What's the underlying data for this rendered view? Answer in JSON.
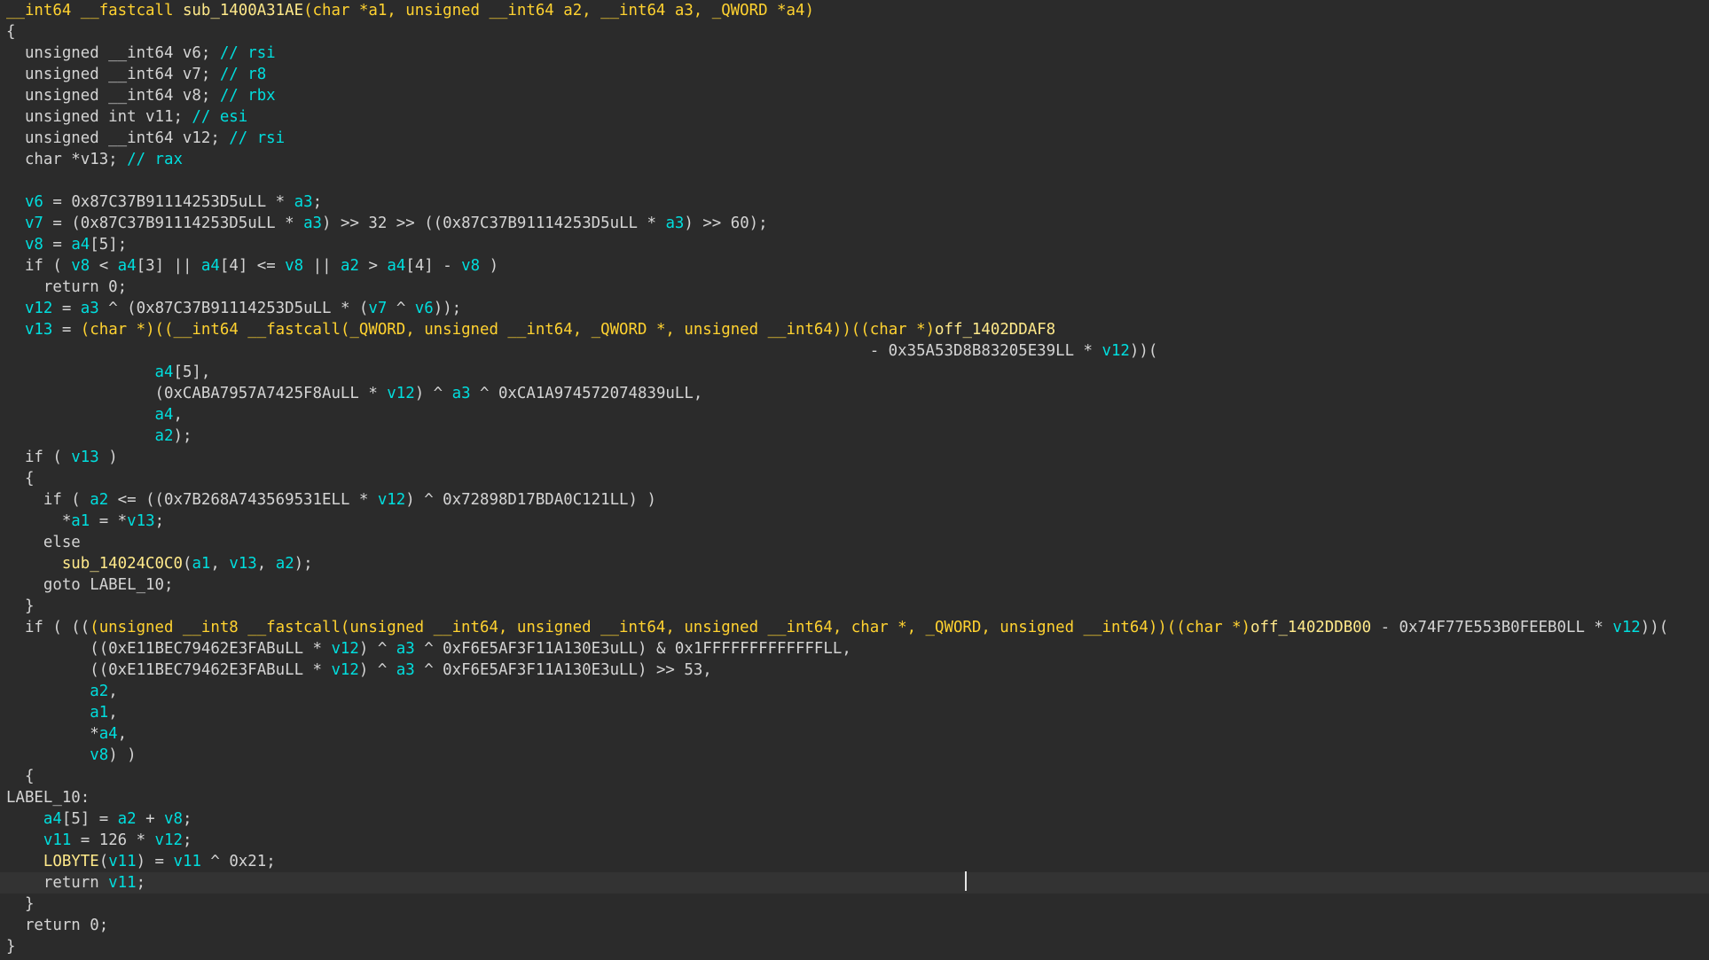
{
  "view": {
    "name": "pseudocode-view",
    "colors": {
      "background": "#2b2b2b",
      "current_line": "#333333",
      "text": "#d4d4d4",
      "variable": "#00dede",
      "function_name": "#ffe98a",
      "type": "#ffd230"
    }
  },
  "code": {
    "current_line_index": 41,
    "lines": [
      [
        [
          "type",
          "__int64 __fastcall "
        ],
        [
          "fn",
          "sub_1400A31AE"
        ],
        [
          "type",
          "(char *a1, unsigned __int64 a2, __int64 a3, _QWORD *a4)"
        ]
      ],
      [
        [
          "text",
          "{"
        ]
      ],
      [
        [
          "text",
          "  unsigned __int64 v6; "
        ],
        [
          "cmt",
          "// rsi"
        ]
      ],
      [
        [
          "text",
          "  unsigned __int64 v7; "
        ],
        [
          "cmt",
          "// r8"
        ]
      ],
      [
        [
          "text",
          "  unsigned __int64 v8; "
        ],
        [
          "cmt",
          "// rbx"
        ]
      ],
      [
        [
          "text",
          "  unsigned int v11; "
        ],
        [
          "cmt",
          "// esi"
        ]
      ],
      [
        [
          "text",
          "  unsigned __int64 v12; "
        ],
        [
          "cmt",
          "// rsi"
        ]
      ],
      [
        [
          "text",
          "  char *v13; "
        ],
        [
          "cmt",
          "// rax"
        ]
      ],
      [
        [
          "text",
          ""
        ]
      ],
      [
        [
          "text",
          "  "
        ],
        [
          "var",
          "v6"
        ],
        [
          "text",
          " = 0x87C37B91114253D5uLL * "
        ],
        [
          "var",
          "a3"
        ],
        [
          "text",
          ";"
        ]
      ],
      [
        [
          "text",
          "  "
        ],
        [
          "var",
          "v7"
        ],
        [
          "text",
          " = (0x87C37B91114253D5uLL * "
        ],
        [
          "var",
          "a3"
        ],
        [
          "text",
          ") >> 32 >> ((0x87C37B91114253D5uLL * "
        ],
        [
          "var",
          "a3"
        ],
        [
          "text",
          ") >> 60);"
        ]
      ],
      [
        [
          "text",
          "  "
        ],
        [
          "var",
          "v8"
        ],
        [
          "text",
          " = "
        ],
        [
          "var",
          "a4"
        ],
        [
          "text",
          "[5];"
        ]
      ],
      [
        [
          "text",
          "  if ( "
        ],
        [
          "var",
          "v8"
        ],
        [
          "text",
          " < "
        ],
        [
          "var",
          "a4"
        ],
        [
          "text",
          "[3] || "
        ],
        [
          "var",
          "a4"
        ],
        [
          "text",
          "[4] <= "
        ],
        [
          "var",
          "v8"
        ],
        [
          "text",
          " || "
        ],
        [
          "var",
          "a2"
        ],
        [
          "text",
          " > "
        ],
        [
          "var",
          "a4"
        ],
        [
          "text",
          "[4] - "
        ],
        [
          "var",
          "v8"
        ],
        [
          "text",
          " )"
        ]
      ],
      [
        [
          "text",
          "    return 0;"
        ]
      ],
      [
        [
          "text",
          "  "
        ],
        [
          "var",
          "v12"
        ],
        [
          "text",
          " = "
        ],
        [
          "var",
          "a3"
        ],
        [
          "text",
          " ^ (0x87C37B91114253D5uLL * ("
        ],
        [
          "var",
          "v7"
        ],
        [
          "text",
          " ^ "
        ],
        [
          "var",
          "v6"
        ],
        [
          "text",
          "));"
        ]
      ],
      [
        [
          "text",
          "  "
        ],
        [
          "var",
          "v13"
        ],
        [
          "text",
          " = "
        ],
        [
          "type",
          "(char *)((__int64 __fastcall(_QWORD, unsigned __int64, _QWORD *, unsigned __int64))((char *)"
        ],
        [
          "fn",
          "off_1402DDAF8"
        ]
      ],
      [
        [
          "text",
          "                                                                                             - 0x35A53D8B83205E39LL * "
        ],
        [
          "var",
          "v12"
        ],
        [
          "text",
          "))("
        ]
      ],
      [
        [
          "text",
          "                "
        ],
        [
          "var",
          "a4"
        ],
        [
          "text",
          "[5],"
        ]
      ],
      [
        [
          "text",
          "                (0xCABA7957A7425F8AuLL * "
        ],
        [
          "var",
          "v12"
        ],
        [
          "text",
          ") ^ "
        ],
        [
          "var",
          "a3"
        ],
        [
          "text",
          " ^ 0xCA1A974572074839uLL,"
        ]
      ],
      [
        [
          "text",
          "                "
        ],
        [
          "var",
          "a4"
        ],
        [
          "text",
          ","
        ]
      ],
      [
        [
          "text",
          "                "
        ],
        [
          "var",
          "a2"
        ],
        [
          "text",
          ");"
        ]
      ],
      [
        [
          "text",
          "  if ( "
        ],
        [
          "var",
          "v13"
        ],
        [
          "text",
          " )"
        ]
      ],
      [
        [
          "text",
          "  {"
        ]
      ],
      [
        [
          "text",
          "    if ( "
        ],
        [
          "var",
          "a2"
        ],
        [
          "text",
          " <= ((0x7B268A743569531ELL * "
        ],
        [
          "var",
          "v12"
        ],
        [
          "text",
          ") ^ 0x72898D17BDA0C121LL) )"
        ]
      ],
      [
        [
          "text",
          "      *"
        ],
        [
          "var",
          "a1"
        ],
        [
          "text",
          " = *"
        ],
        [
          "var",
          "v13"
        ],
        [
          "text",
          ";"
        ]
      ],
      [
        [
          "text",
          "    else"
        ]
      ],
      [
        [
          "text",
          "      "
        ],
        [
          "fn",
          "sub_14024C0C0"
        ],
        [
          "text",
          "("
        ],
        [
          "var",
          "a1"
        ],
        [
          "text",
          ", "
        ],
        [
          "var",
          "v13"
        ],
        [
          "text",
          ", "
        ],
        [
          "var",
          "a2"
        ],
        [
          "text",
          ");"
        ]
      ],
      [
        [
          "text",
          "    goto LABEL_10;"
        ]
      ],
      [
        [
          "text",
          "  }"
        ]
      ],
      [
        [
          "text",
          "  if ( (("
        ],
        [
          "type",
          "(unsigned __int8 __fastcall(unsigned __int64, unsigned __int64, unsigned __int64, char *, _QWORD, unsigned __int64))((char *)"
        ],
        [
          "fn",
          "off_1402DDB00"
        ],
        [
          "text",
          " - 0x74F77E553B0FEEB0LL * "
        ],
        [
          "var",
          "v12"
        ],
        [
          "text",
          "))("
        ]
      ],
      [
        [
          "text",
          "         ((0xE11BEC79462E3FABuLL * "
        ],
        [
          "var",
          "v12"
        ],
        [
          "text",
          ") ^ "
        ],
        [
          "var",
          "a3"
        ],
        [
          "text",
          " ^ 0xF6E5AF3F11A130E3uLL) & 0x1FFFFFFFFFFFFFLL,"
        ]
      ],
      [
        [
          "text",
          "         ((0xE11BEC79462E3FABuLL * "
        ],
        [
          "var",
          "v12"
        ],
        [
          "text",
          ") ^ "
        ],
        [
          "var",
          "a3"
        ],
        [
          "text",
          " ^ 0xF6E5AF3F11A130E3uLL) >> 53,"
        ]
      ],
      [
        [
          "text",
          "         "
        ],
        [
          "var",
          "a2"
        ],
        [
          "text",
          ","
        ]
      ],
      [
        [
          "text",
          "         "
        ],
        [
          "var",
          "a1"
        ],
        [
          "text",
          ","
        ]
      ],
      [
        [
          "text",
          "         *"
        ],
        [
          "var",
          "a4"
        ],
        [
          "text",
          ","
        ]
      ],
      [
        [
          "text",
          "         "
        ],
        [
          "var",
          "v8"
        ],
        [
          "text",
          ") )"
        ]
      ],
      [
        [
          "text",
          "  {"
        ]
      ],
      [
        [
          "text",
          "LABEL_10:"
        ]
      ],
      [
        [
          "text",
          "    "
        ],
        [
          "var",
          "a4"
        ],
        [
          "text",
          "[5] = "
        ],
        [
          "var",
          "a2"
        ],
        [
          "text",
          " + "
        ],
        [
          "var",
          "v8"
        ],
        [
          "text",
          ";"
        ]
      ],
      [
        [
          "text",
          "    "
        ],
        [
          "var",
          "v11"
        ],
        [
          "text",
          " = 126 * "
        ],
        [
          "var",
          "v12"
        ],
        [
          "text",
          ";"
        ]
      ],
      [
        [
          "fn",
          "    LOBYTE"
        ],
        [
          "text",
          "("
        ],
        [
          "var",
          "v11"
        ],
        [
          "text",
          ") = "
        ],
        [
          "var",
          "v11"
        ],
        [
          "text",
          " ^ 0x21;"
        ]
      ],
      [
        [
          "text",
          "    return "
        ],
        [
          "var",
          "v11"
        ],
        [
          "text",
          ";"
        ]
      ],
      [
        [
          "text",
          "  }"
        ]
      ],
      [
        [
          "text",
          "  return 0;"
        ]
      ],
      [
        [
          "text",
          "}"
        ]
      ]
    ]
  }
}
